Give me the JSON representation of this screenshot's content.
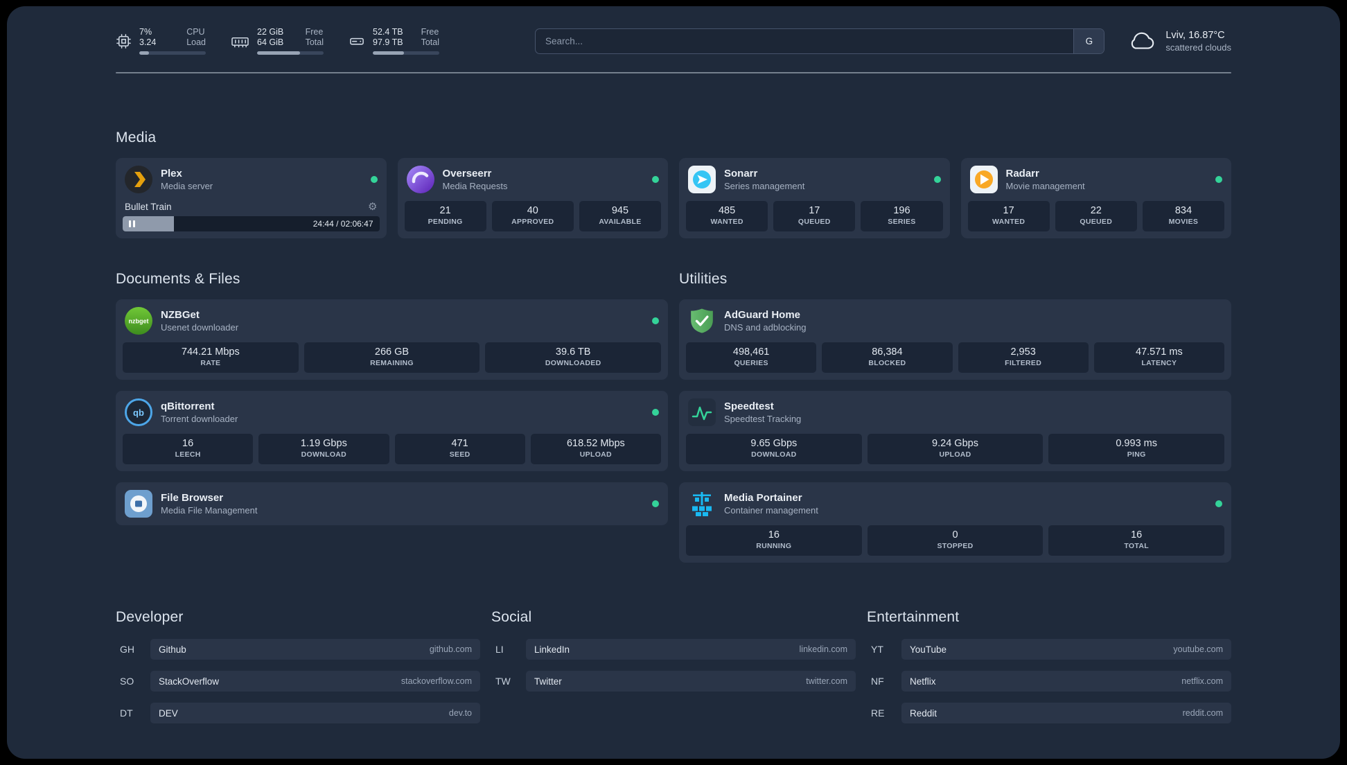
{
  "colors": {
    "status_online": "#34d399",
    "panel_bg": "#1f2a3b",
    "card_bg": "#2a3548",
    "tile_bg": "#1b2536",
    "plex_accent": "#e5a00d"
  },
  "icons": {
    "settings": "⚙"
  },
  "topbar": {
    "cpu": {
      "value_top": "7%",
      "value_bottom": "3.24",
      "label_top": "CPU",
      "label_bottom": "Load",
      "bar_percent": 15
    },
    "memory": {
      "value_top": "22 GiB",
      "value_bottom": "64 GiB",
      "label_top": "Free",
      "label_bottom": "Total",
      "bar_percent": 65
    },
    "disk": {
      "value_top": "52.4 TB",
      "value_bottom": "97.9 TB",
      "label_top": "Free",
      "label_bottom": "Total",
      "bar_percent": 47
    },
    "search": {
      "placeholder": "Search...",
      "button_label": "G"
    },
    "weather": {
      "location": "Lviv, 16.87°C",
      "condition": "scattered clouds"
    }
  },
  "media": {
    "title": "Media",
    "plex": {
      "name": "Plex",
      "subtitle": "Media server",
      "online": true,
      "now_playing": "Bullet Train",
      "time": "24:44 / 02:06:47",
      "progress_percent": 20
    },
    "overseerr": {
      "name": "Overseerr",
      "subtitle": "Media Requests",
      "online": true,
      "stats": [
        {
          "value": "21",
          "label": "PENDING"
        },
        {
          "value": "40",
          "label": "APPROVED"
        },
        {
          "value": "945",
          "label": "AVAILABLE"
        }
      ]
    },
    "sonarr": {
      "name": "Sonarr",
      "subtitle": "Series management",
      "online": true,
      "stats": [
        {
          "value": "485",
          "label": "WANTED"
        },
        {
          "value": "17",
          "label": "QUEUED"
        },
        {
          "value": "196",
          "label": "SERIES"
        }
      ]
    },
    "radarr": {
      "name": "Radarr",
      "subtitle": "Movie management",
      "online": true,
      "stats": [
        {
          "value": "17",
          "label": "WANTED"
        },
        {
          "value": "22",
          "label": "QUEUED"
        },
        {
          "value": "834",
          "label": "MOVIES"
        }
      ]
    }
  },
  "documents": {
    "title": "Documents & Files",
    "nzbget": {
      "name": "NZBGet",
      "subtitle": "Usenet downloader",
      "online": true,
      "icon_text": "nzbget",
      "stats": [
        {
          "value": "744.21 Mbps",
          "label": "RATE"
        },
        {
          "value": "266 GB",
          "label": "REMAINING"
        },
        {
          "value": "39.6 TB",
          "label": "DOWNLOADED"
        }
      ]
    },
    "qbittorrent": {
      "name": "qBittorrent",
      "subtitle": "Torrent downloader",
      "online": true,
      "icon_text": "qb",
      "stats": [
        {
          "value": "16",
          "label": "LEECH"
        },
        {
          "value": "1.19 Gbps",
          "label": "DOWNLOAD"
        },
        {
          "value": "471",
          "label": "SEED"
        },
        {
          "value": "618.52 Mbps",
          "label": "UPLOAD"
        }
      ]
    },
    "filebrowser": {
      "name": "File Browser",
      "subtitle": "Media File Management",
      "online": true
    }
  },
  "utilities": {
    "title": "Utilities",
    "adguard": {
      "name": "AdGuard Home",
      "subtitle": "DNS and adblocking",
      "stats": [
        {
          "value": "498,461",
          "label": "QUERIES"
        },
        {
          "value": "86,384",
          "label": "BLOCKED"
        },
        {
          "value": "2,953",
          "label": "FILTERED"
        },
        {
          "value": "47.571 ms",
          "label": "LATENCY"
        }
      ]
    },
    "speedtest": {
      "name": "Speedtest",
      "subtitle": "Speedtest Tracking",
      "stats": [
        {
          "value": "9.65 Gbps",
          "label": "DOWNLOAD"
        },
        {
          "value": "9.24 Gbps",
          "label": "UPLOAD"
        },
        {
          "value": "0.993 ms",
          "label": "PING"
        }
      ]
    },
    "portainer": {
      "name": "Media Portainer",
      "subtitle": "Container management",
      "online": true,
      "stats": [
        {
          "value": "16",
          "label": "RUNNING"
        },
        {
          "value": "0",
          "label": "STOPPED"
        },
        {
          "value": "16",
          "label": "TOTAL"
        }
      ]
    }
  },
  "bookmarks": [
    {
      "title": "Developer",
      "items": [
        {
          "abbr": "GH",
          "name": "Github",
          "url": "github.com"
        },
        {
          "abbr": "SO",
          "name": "StackOverflow",
          "url": "stackoverflow.com"
        },
        {
          "abbr": "DT",
          "name": "DEV",
          "url": "dev.to"
        }
      ]
    },
    {
      "title": "Social",
      "items": [
        {
          "abbr": "LI",
          "name": "LinkedIn",
          "url": "linkedin.com"
        },
        {
          "abbr": "TW",
          "name": "Twitter",
          "url": "twitter.com"
        }
      ]
    },
    {
      "title": "Entertainment",
      "items": [
        {
          "abbr": "YT",
          "name": "YouTube",
          "url": "youtube.com"
        },
        {
          "abbr": "NF",
          "name": "Netflix",
          "url": "netflix.com"
        },
        {
          "abbr": "RE",
          "name": "Reddit",
          "url": "reddit.com"
        }
      ]
    }
  ]
}
